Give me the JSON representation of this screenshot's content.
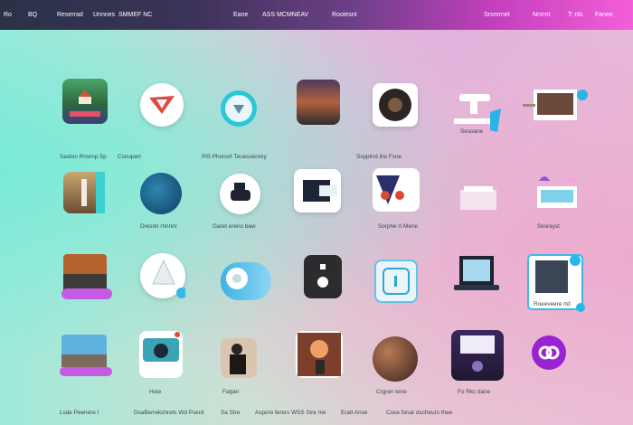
{
  "topbar": {
    "items": [
      "Ro",
      "BQ",
      "Reserrad",
      "Unnnes",
      "SMMEF NC",
      "Eane",
      "ASS MCMNEAV",
      "Rooiesnt",
      "Srsnrrnet",
      "Nnrrnt",
      "T: nls",
      "Fanee"
    ]
  },
  "labels": {
    "row1_a": "Saston Rnsrnp  Sp",
    "row1_b": "Csnupert",
    "row1_c": "PiS Phonsrt Teuessenrey",
    "row1_d": "Sspplrrd ihe Fsne",
    "row1_e": "Sesoane",
    "row2_a": "Dresnn rnnnnr",
    "row2_b": "Garet ereno baw",
    "row2_c": "Sorphe rt Mene",
    "row2_d": "Sesrayst",
    "row3_a": "Roeeveere rtd",
    "row4_a": "Hoie",
    "row4_b": "Fatper",
    "row4_c": "Crgren tene",
    "row4_d": "Fo Rkc dane",
    "footer_1": "Lsde Peenere  I",
    "footer_2": "DsaBerrekshrets Wd Pserd",
    "footer_3": "Sa  Stre",
    "footer_4": "Aspore ferers WSS Sire me",
    "footer_5": "Eratt  Anse",
    "footer_6": "Cuse fonar dscheurs thee"
  },
  "apps": [
    "landscape-photo-icon",
    "paper-plane-icon",
    "compass-icon",
    "sunset-photo-icon",
    "coffee-icon",
    "cloud-tag-icon",
    "photo-card-icon",
    "lighthouse-icon",
    "globe-icon",
    "gamepad-icon",
    "camera-box-icon",
    "character-icon",
    "laptop-window-icon",
    "cake-icon",
    "city-photo-icon",
    "sailboat-icon",
    "toggle-icon",
    "speaker-icon",
    "info-icon",
    "laptop-icon",
    "building-card-icon",
    "beach-photo-icon",
    "camera-tablet-icon",
    "person-photo-icon",
    "fire-photo-icon",
    "orb-icon",
    "monitor-icon",
    "link-icon"
  ]
}
